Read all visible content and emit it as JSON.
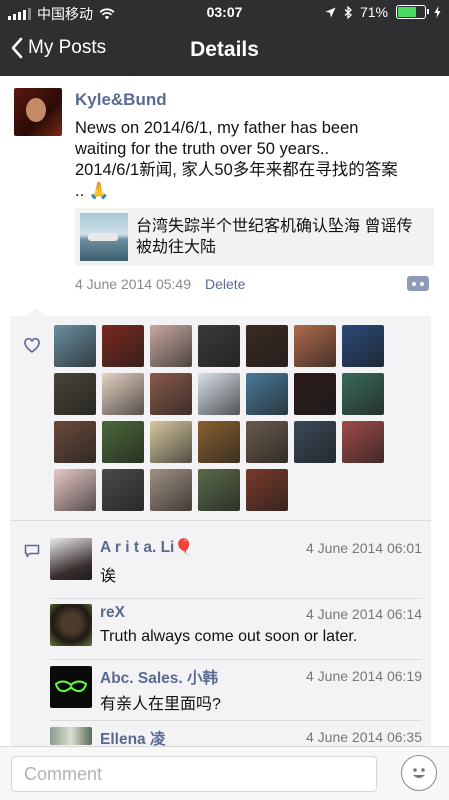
{
  "status_bar": {
    "carrier": "中国移动",
    "time": "03:07",
    "battery_percent": "71%",
    "battery_level": 0.71,
    "battery_color": "#4cd964"
  },
  "nav": {
    "back_label": "My Posts",
    "title": "Details"
  },
  "post": {
    "author": "Kyle&Bund",
    "text_line1": "News on 2014/6/1, my father has been",
    "text_line2": "waiting for the truth over 50 years..",
    "text_line3": "2014/6/1新闻, 家人50多年来都在寻找的答案",
    "text_line4": ".. 🙏",
    "link_title": "台湾失踪半个世纪客机确认坠海 曾谣传被劫往大陆",
    "timestamp": "4 June 2014 05:49",
    "delete_label": "Delete"
  },
  "likes": {
    "icon": "heart-outline-icon",
    "avatar_count": 26
  },
  "comments": {
    "icon": "comment-bubble-icon",
    "items": [
      {
        "name": "A r i t a. Li🎈",
        "time": "4 June 2014 06:01",
        "text": "诶"
      },
      {
        "name": "reX",
        "time": "4 June 2014 06:14",
        "text": "Truth always come out soon or later."
      },
      {
        "name": "Abc. Sales. 小韩",
        "time": "4 June 2014 06:19",
        "text": "有亲人在里面吗?"
      },
      {
        "name": "Ellena 凌",
        "time": "4 June 2014 06:35",
        "text": ""
      }
    ]
  },
  "composer": {
    "placeholder": "Comment",
    "emoji_icon": "smiley-face-icon"
  },
  "colors": {
    "header_bg": "#2f2f31",
    "name_blue": "#5b6a91",
    "panel_bg": "#f3f3f5"
  }
}
